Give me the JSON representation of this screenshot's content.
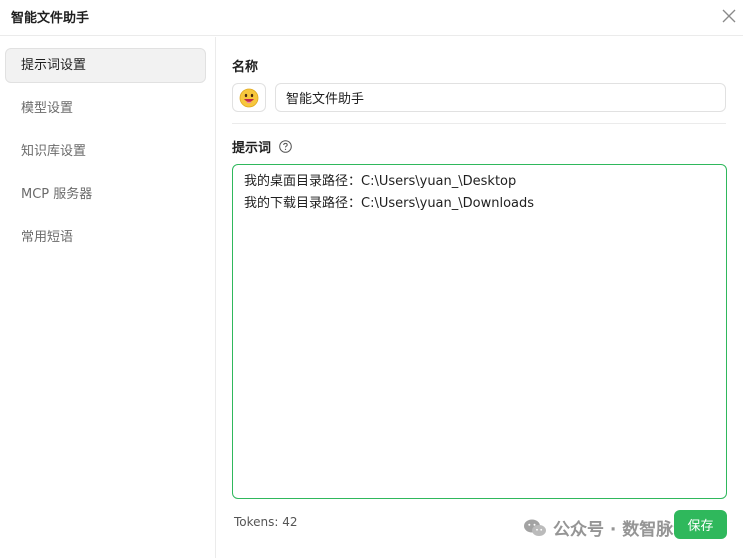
{
  "window": {
    "title": "智能文件助手"
  },
  "sidebar": {
    "items": [
      {
        "label": "提示词设置",
        "active": true
      },
      {
        "label": "模型设置",
        "active": false
      },
      {
        "label": "知识库设置",
        "active": false
      },
      {
        "label": "MCP 服务器",
        "active": false
      },
      {
        "label": "常用短语",
        "active": false
      }
    ]
  },
  "main": {
    "name_label": "名称",
    "avatar_icon": "grinning-face-emoji-icon",
    "name_value": "智能文件助手",
    "prompt_label": "提示词",
    "prompt_lines": [
      "我的桌面目录路径：C:\\Users\\yuan_\\Desktop",
      "我的下载目录路径：C:\\Users\\yuan_\\Downloads"
    ],
    "tokens_text": "Tokens: 42",
    "save_label": "保存"
  },
  "watermark": {
    "text": "公众号 · 数智脉动"
  },
  "colors": {
    "accent": "#2fb85c",
    "active_bg": "#f2f2f2",
    "muted_text": "#6b6b6b"
  }
}
